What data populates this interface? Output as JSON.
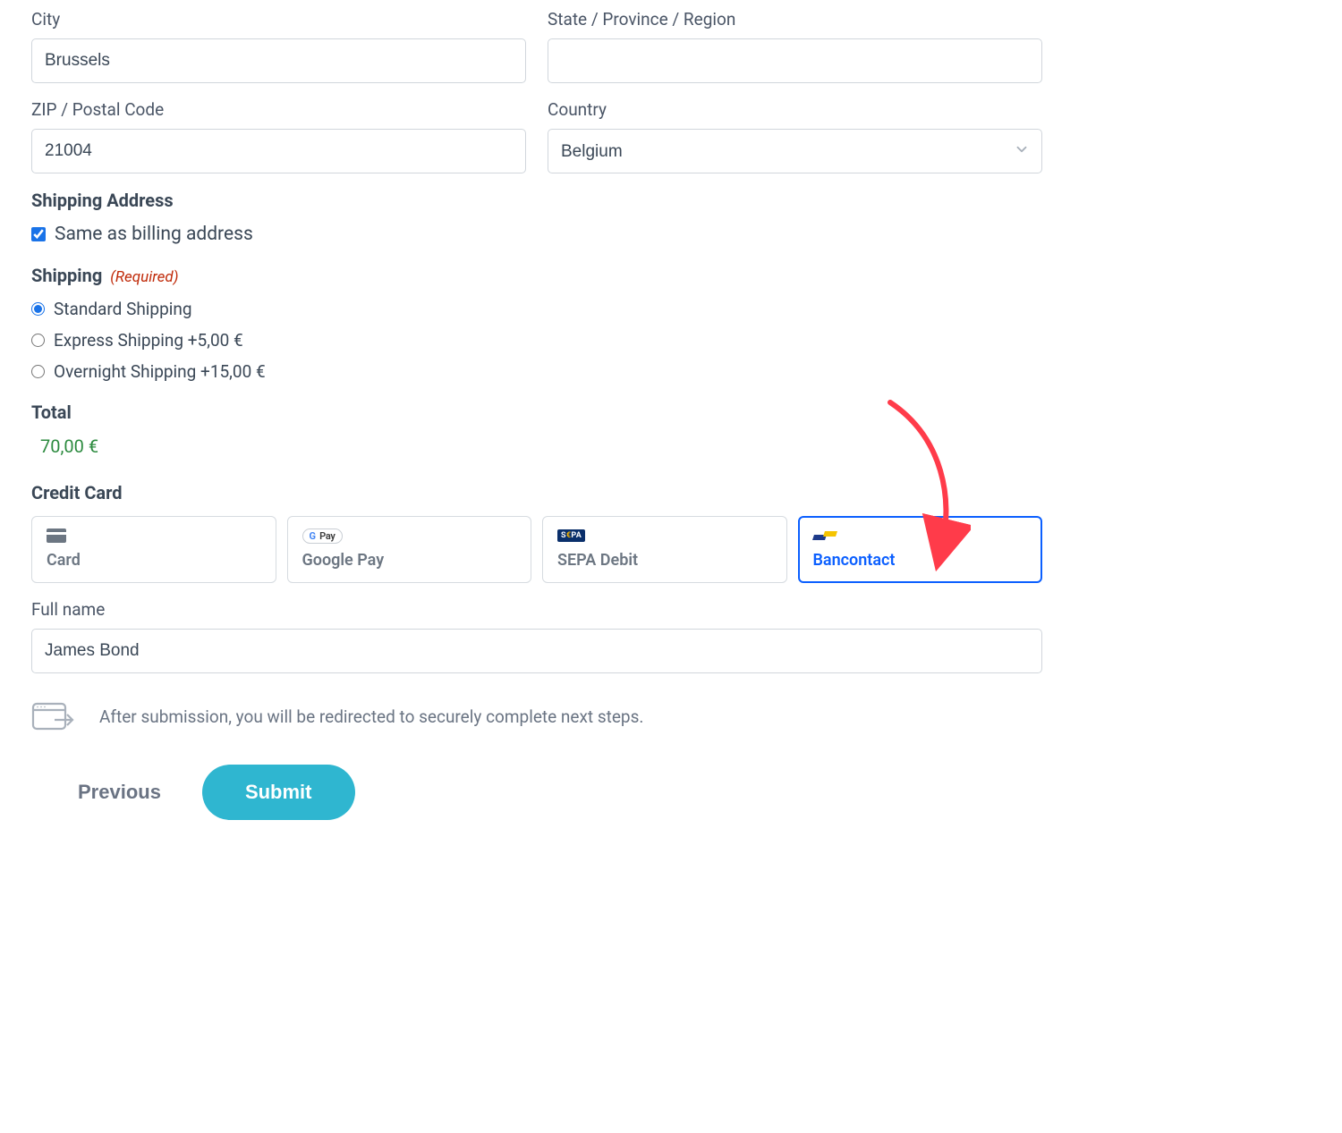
{
  "address": {
    "city_label": "City",
    "city_value": "Brussels",
    "state_label": "State / Province / Region",
    "state_value": "",
    "zip_label": "ZIP / Postal Code",
    "zip_value": "21004",
    "country_label": "Country",
    "country_value": "Belgium"
  },
  "shipping_address": {
    "heading": "Shipping Address",
    "same_as_label": "Same as billing address",
    "same_as_checked": true
  },
  "shipping": {
    "heading": "Shipping",
    "required_tag": "(Required)",
    "options": [
      {
        "label": "Standard Shipping",
        "selected": true
      },
      {
        "label": "Express Shipping +5,00 €",
        "selected": false
      },
      {
        "label": "Overnight Shipping +15,00 €",
        "selected": false
      }
    ]
  },
  "total": {
    "heading": "Total",
    "value": "70,00 €"
  },
  "payment": {
    "heading": "Credit Card",
    "methods": [
      {
        "id": "card",
        "label": "Card",
        "selected": false
      },
      {
        "id": "google_pay",
        "label": "Google Pay",
        "selected": false
      },
      {
        "id": "sepa",
        "label": "SEPA Debit",
        "selected": false
      },
      {
        "id": "bancontact",
        "label": "Bancontact",
        "selected": true
      }
    ],
    "full_name_label": "Full name",
    "full_name_value": "James Bond",
    "redirect_note": "After submission, you will be redirected to securely complete next steps."
  },
  "buttons": {
    "previous": "Previous",
    "submit": "Submit"
  },
  "misc": {
    "gpay_text": "G Pay",
    "sepa_text_a": "S",
    "sepa_text_euro": "€",
    "sepa_text_b": "PA"
  }
}
